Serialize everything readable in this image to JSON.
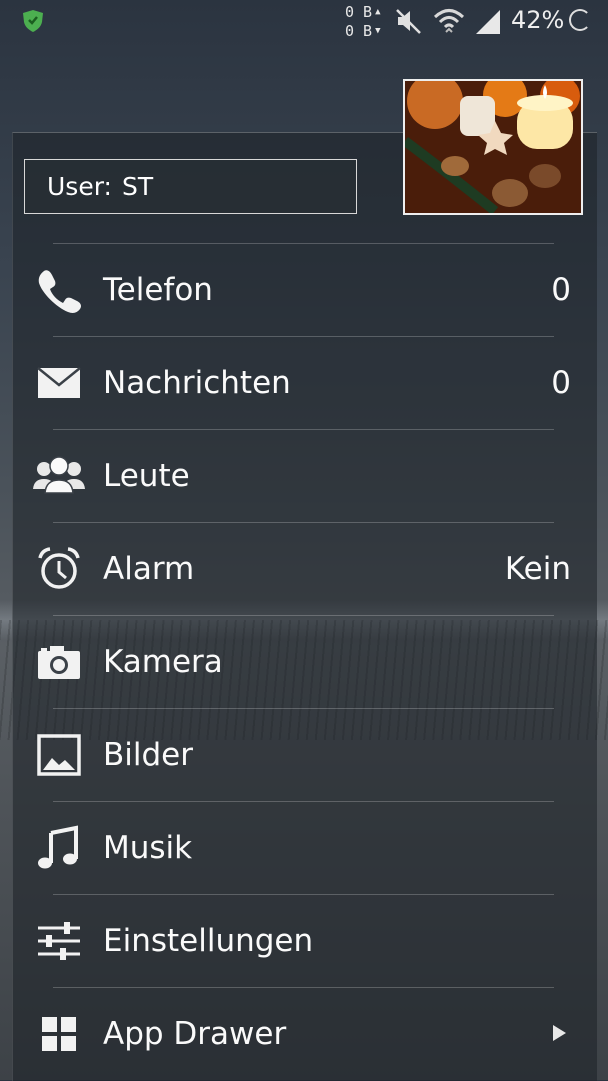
{
  "statusbar": {
    "traffic_up": "0 B",
    "traffic_down": "0 B",
    "battery": "42%",
    "icons": [
      "shield-icon",
      "mute-icon",
      "wifi-icon",
      "signal-icon",
      "battery-ring-icon"
    ]
  },
  "user": {
    "label": "User:",
    "value": "ST"
  },
  "photo": {
    "description_icon": "candle-photo"
  },
  "menu": [
    {
      "label": "Telefon",
      "value": "0",
      "icon": "phone-icon"
    },
    {
      "label": "Nachrichten",
      "value": "0",
      "icon": "envelope-icon"
    },
    {
      "label": "Leute",
      "value": "",
      "icon": "people-icon"
    },
    {
      "label": "Alarm",
      "value": "Kein",
      "icon": "alarm-clock-icon"
    },
    {
      "label": "Kamera",
      "value": "",
      "icon": "camera-icon"
    },
    {
      "label": "Bilder",
      "value": "",
      "icon": "picture-icon"
    },
    {
      "label": "Musik",
      "value": "",
      "icon": "music-note-icon"
    },
    {
      "label": "Einstellungen",
      "value": "",
      "icon": "sliders-icon"
    },
    {
      "label": "App Drawer",
      "value": "",
      "icon": "app-grid-icon"
    }
  ],
  "colors": {
    "text": "#fafafa",
    "shield": "#4caf50"
  }
}
